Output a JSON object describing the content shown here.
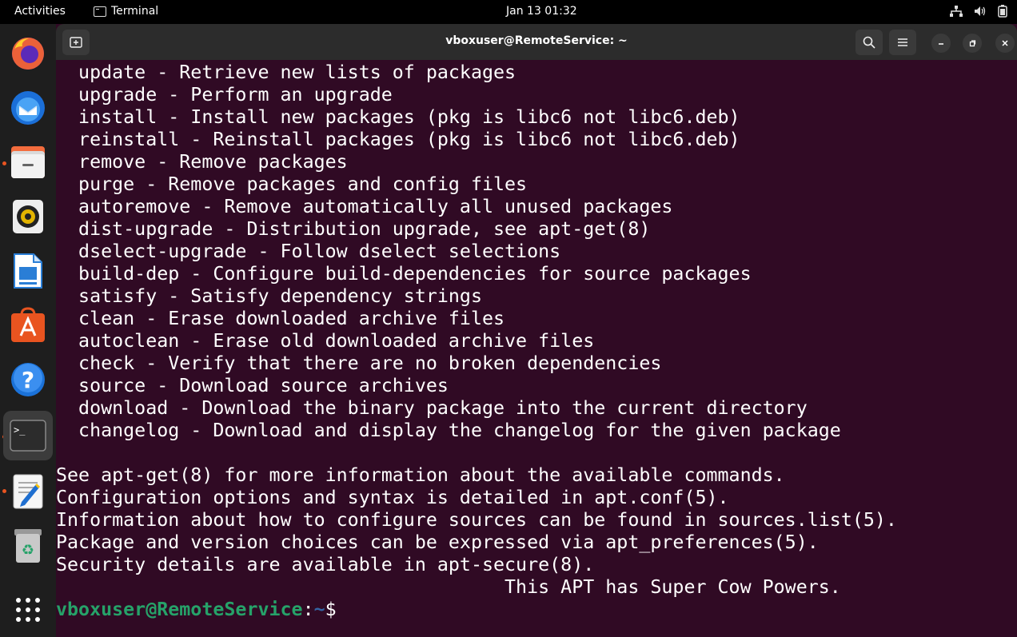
{
  "topbar": {
    "activities": "Activities",
    "app_name": "Terminal",
    "clock": "Jan 13  01:32"
  },
  "dock": {
    "items": [
      {
        "name": "firefox"
      },
      {
        "name": "thunderbird"
      },
      {
        "name": "files"
      },
      {
        "name": "rhythmbox"
      },
      {
        "name": "libreoffice-writer"
      },
      {
        "name": "app-center"
      },
      {
        "name": "help"
      },
      {
        "name": "terminal"
      },
      {
        "name": "text-editor"
      },
      {
        "name": "trash"
      },
      {
        "name": "show-apps"
      }
    ]
  },
  "window": {
    "title": "vboxuser@RemoteService: ~"
  },
  "terminal": {
    "lines": [
      "  update - Retrieve new lists of packages",
      "  upgrade - Perform an upgrade",
      "  install - Install new packages (pkg is libc6 not libc6.deb)",
      "  reinstall - Reinstall packages (pkg is libc6 not libc6.deb)",
      "  remove - Remove packages",
      "  purge - Remove packages and config files",
      "  autoremove - Remove automatically all unused packages",
      "  dist-upgrade - Distribution upgrade, see apt-get(8)",
      "  dselect-upgrade - Follow dselect selections",
      "  build-dep - Configure build-dependencies for source packages",
      "  satisfy - Satisfy dependency strings",
      "  clean - Erase downloaded archive files",
      "  autoclean - Erase old downloaded archive files",
      "  check - Verify that there are no broken dependencies",
      "  source - Download source archives",
      "  download - Download the binary package into the current directory",
      "  changelog - Download and display the changelog for the given package",
      "",
      "See apt-get(8) for more information about the available commands.",
      "Configuration options and syntax is detailed in apt.conf(5).",
      "Information about how to configure sources can be found in sources.list(5).",
      "Package and version choices can be expressed via apt_preferences(5).",
      "Security details are available in apt-secure(8).",
      "                                        This APT has Super Cow Powers."
    ],
    "prompt_user": "vboxuser@RemoteService",
    "prompt_sep": ":",
    "prompt_path": "~",
    "prompt_symbol": "$"
  },
  "colors": {
    "terminal_bg": "#300a24",
    "prompt_user": "#26a269",
    "prompt_path": "#3465a4",
    "accent": "#e95420"
  }
}
